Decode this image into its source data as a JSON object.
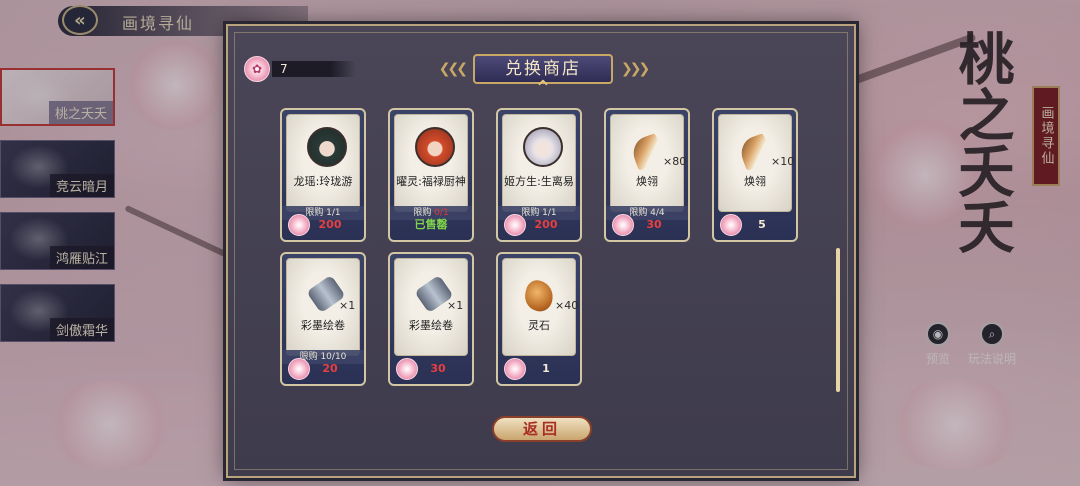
{
  "header": {
    "back_icon": "back-arrow-icon",
    "title": "画境寻仙"
  },
  "sidebar": {
    "items": [
      {
        "label": "桃之夭夭",
        "active": true
      },
      {
        "label": "竞云暗月",
        "active": false
      },
      {
        "label": "鸿雁贴江",
        "active": false
      },
      {
        "label": "剑傲霜华",
        "active": false
      }
    ]
  },
  "right_panel": {
    "calligraphy": "桃之夭夭",
    "seal": "画境寻仙",
    "buttons": [
      {
        "label": "预览",
        "icon": "eye-icon"
      },
      {
        "label": "玩法说明",
        "icon": "magnifier-icon"
      }
    ]
  },
  "modal": {
    "title": "兑换商店",
    "currency": {
      "icon": "peach-blossom-icon",
      "amount": "7"
    },
    "items": [
      {
        "name": "龙瑶:玲珑游",
        "limit": "限购 1/1",
        "limit_alert": "",
        "price": "200",
        "owned": false,
        "icon": "portrait-longyao",
        "qty": ""
      },
      {
        "name": "曜灵:福禄厨神",
        "limit": "限购 ",
        "limit_alert": "0/1",
        "price": "已售罄",
        "owned": true,
        "icon": "portrait-yaoling",
        "qty": ""
      },
      {
        "name": "姬方生:生离易",
        "limit": "限购 1/1",
        "limit_alert": "",
        "price": "200",
        "owned": false,
        "icon": "portrait-jifangsheng",
        "qty": ""
      },
      {
        "name": "焕翎",
        "limit": "限购 4/4",
        "limit_alert": "",
        "price": "30",
        "owned": false,
        "icon": "feather-icon",
        "qty": "×80"
      },
      {
        "name": "焕翎",
        "limit": "",
        "limit_alert": "",
        "price": "5",
        "owned": false,
        "icon": "feather-icon",
        "qty": "×10"
      },
      {
        "name": "彩墨绘卷",
        "limit": "限购 10/10",
        "limit_alert": "",
        "price": "20",
        "owned": false,
        "icon": "scroll-icon",
        "qty": "×1"
      },
      {
        "name": "彩墨绘卷",
        "limit": "",
        "limit_alert": "",
        "price": "30",
        "owned": false,
        "icon": "scroll-icon",
        "qty": "×1"
      },
      {
        "name": "灵石",
        "limit": "",
        "limit_alert": "",
        "price": "1",
        "owned": false,
        "icon": "spirit-stone-icon",
        "qty": "×40"
      }
    ],
    "return_label": "返回"
  },
  "colors": {
    "price_red": "#e64040",
    "sold_out_green": "#7fd34a",
    "gold_border": "#c9a865"
  }
}
